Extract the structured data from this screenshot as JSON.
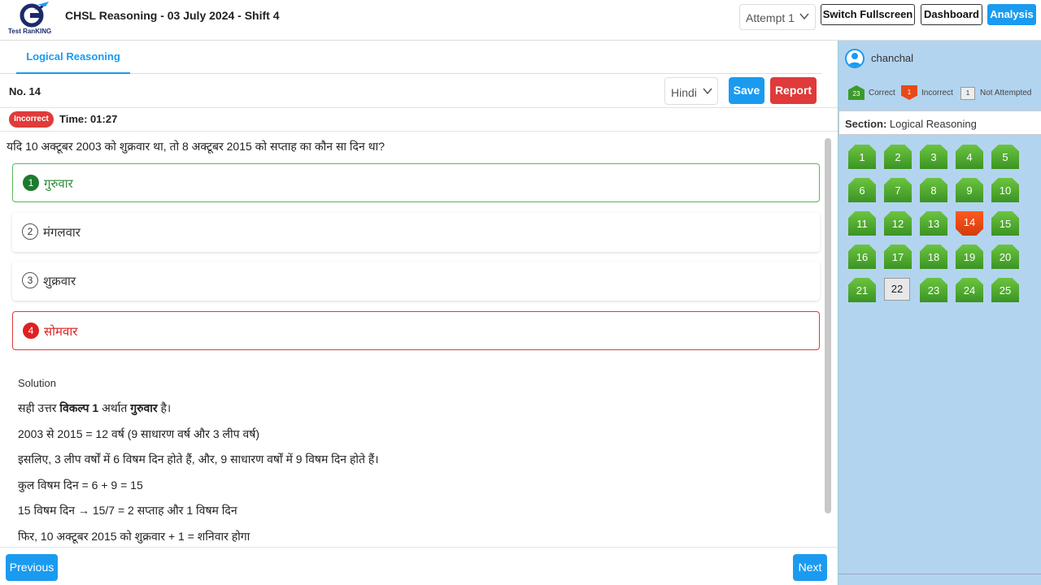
{
  "header": {
    "logo_text": "Test RanKING",
    "title": "CHSL Reasoning - 03 July 2024 - Shift 4",
    "attempt_select": "Attempt 1",
    "switch_fullscreen": "Switch Fullscreen",
    "dashboard": "Dashboard",
    "analysis": "Analysis"
  },
  "tabs": [
    {
      "label": "Logical Reasoning"
    }
  ],
  "question_bar": {
    "number": "No. 14",
    "language": "Hindi",
    "save": "Save",
    "report": "Report"
  },
  "status": {
    "badge": "Incorrect",
    "time": "Time: 01:27"
  },
  "question": {
    "text": "यदि 10 अक्टूबर 2003 को शुक्रवार था, तो 8 अक्टूबर 2015 को सप्ताह का कौन सा दिन था?",
    "options": [
      {
        "num": "1",
        "text": "गुरुवार",
        "state": "correct"
      },
      {
        "num": "2",
        "text": "मंगलवार",
        "state": "none"
      },
      {
        "num": "3",
        "text": "शुक्रवार",
        "state": "none"
      },
      {
        "num": "4",
        "text": "सोमवार",
        "state": "wrong"
      }
    ]
  },
  "solution": {
    "title": "Solution",
    "line1_pre": "सही उत्तर ",
    "line1_bold1": "विकल्प 1",
    "line1_mid": " अर्थात ",
    "line1_bold2": "गुरुवार",
    "line1_post": " है।",
    "line2": "2003 से 2015 = 12 वर्ष (9 साधारण वर्ष और 3 लीप वर्ष)",
    "line3": "इसलिए, 3 लीप वर्षों में 6 विषम दिन होते हैं, और, 9 साधारण वर्षों में 9 विषम दिन होते हैं।",
    "line4": "कुल विषम दिन = 6 + 9 = 15",
    "line5": "15 विषम दिन → 15/7 = 2 सप्ताह और 1 विषम दिन",
    "line6": "फिर, 10 अक्टूबर 2015 को शुक्रवार + 1 = शनिवार होगा"
  },
  "footer": {
    "previous": "Previous",
    "next": "Next"
  },
  "side": {
    "username": "chanchal",
    "legend": {
      "correct_count": "23",
      "correct_label": "Correct",
      "incorrect_count": "1",
      "incorrect_label": "Incorrect",
      "na_count": "1",
      "na_label": "Not Attempted"
    },
    "section_label": "Section:",
    "section_name": "Logical Reasoning",
    "questions": [
      {
        "n": "1",
        "s": "correct"
      },
      {
        "n": "2",
        "s": "correct"
      },
      {
        "n": "3",
        "s": "correct"
      },
      {
        "n": "4",
        "s": "correct"
      },
      {
        "n": "5",
        "s": "correct"
      },
      {
        "n": "6",
        "s": "correct"
      },
      {
        "n": "7",
        "s": "correct"
      },
      {
        "n": "8",
        "s": "correct"
      },
      {
        "n": "9",
        "s": "correct"
      },
      {
        "n": "10",
        "s": "correct"
      },
      {
        "n": "11",
        "s": "correct"
      },
      {
        "n": "12",
        "s": "correct"
      },
      {
        "n": "13",
        "s": "correct"
      },
      {
        "n": "14",
        "s": "incorrect"
      },
      {
        "n": "15",
        "s": "correct"
      },
      {
        "n": "16",
        "s": "correct"
      },
      {
        "n": "17",
        "s": "correct"
      },
      {
        "n": "18",
        "s": "correct"
      },
      {
        "n": "19",
        "s": "correct"
      },
      {
        "n": "20",
        "s": "correct"
      },
      {
        "n": "21",
        "s": "correct"
      },
      {
        "n": "22",
        "s": "na"
      },
      {
        "n": "23",
        "s": "correct"
      },
      {
        "n": "24",
        "s": "correct"
      },
      {
        "n": "25",
        "s": "correct"
      }
    ]
  },
  "colors": {
    "accent": "#1a9bf0",
    "danger": "#e03a3a",
    "correct": "#3d9a2a",
    "side_bg": "#b3d4ef"
  }
}
